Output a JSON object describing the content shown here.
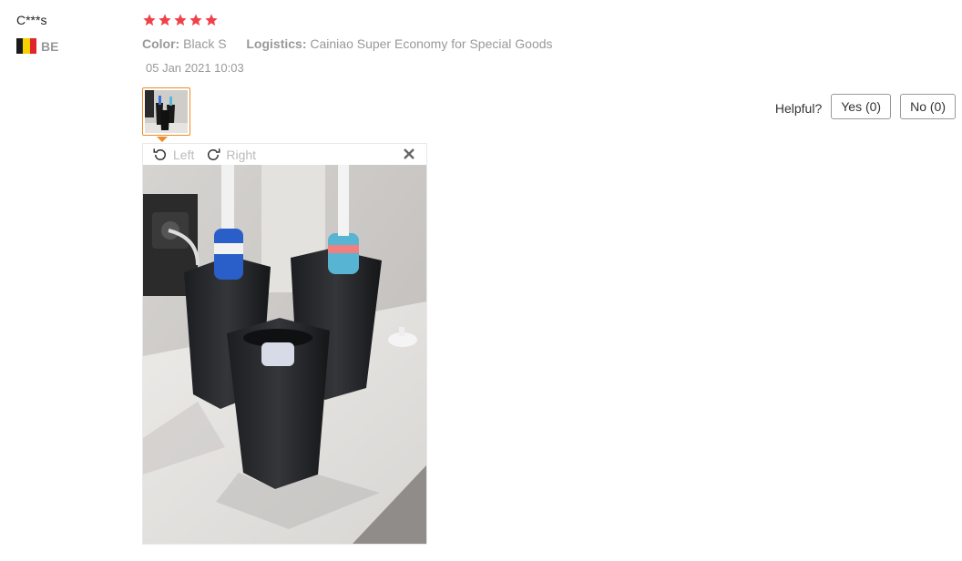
{
  "review": {
    "user": "C***s",
    "country_code": "BE",
    "rating": 5,
    "color_label": "Color:",
    "color_value": "Black S",
    "logistics_label": "Logistics:",
    "logistics_value": "Cainiao Super Economy for Special Goods",
    "date": "05 Jan 2021 10:03"
  },
  "viewer": {
    "rotate_left_label": "Left",
    "rotate_right_label": "Right"
  },
  "helpful": {
    "label": "Helpful?",
    "yes_label": "Yes (0)",
    "no_label": "No (0)"
  },
  "colors": {
    "star": "#f0414b",
    "thumb_border": "#f08a24",
    "flag": [
      "#1a1a1a",
      "#f5d100",
      "#e0262b"
    ]
  }
}
